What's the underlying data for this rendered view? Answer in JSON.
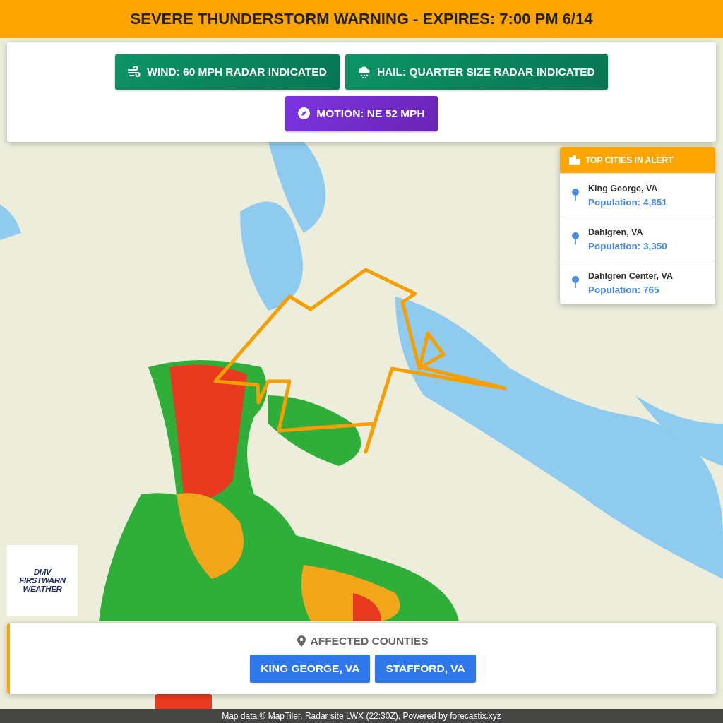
{
  "alert_banner": {
    "title": "SEVERE THUNDERSTORM WARNING - EXPIRES: 7:00 PM 6/14"
  },
  "hazard_tags": [
    {
      "kind": "wind",
      "text": "WIND: 60 MPH RADAR INDICATED"
    },
    {
      "kind": "hail",
      "text": "HAIL: QUARTER SIZE RADAR INDICATED"
    },
    {
      "kind": "motion",
      "text": "MOTION: NE 52 MPH"
    }
  ],
  "top_cities": {
    "title": "TOP CITIES IN ALERT",
    "cities": [
      {
        "name": "King George, VA",
        "population": "Population: 4,851"
      },
      {
        "name": "Dahlgren, VA",
        "population": "Population: 3,350"
      },
      {
        "name": "Dahlgren Center, VA",
        "population": "Population: 765"
      }
    ]
  },
  "logo": {
    "lines": [
      "DMV",
      "FIRSTWARN",
      "WEATHER"
    ]
  },
  "affected_counties": {
    "title": "AFFECTED COUNTIES",
    "counties": [
      "KING GEORGE, VA",
      "STAFFORD, VA"
    ]
  },
  "attribution": "Map data © MapTiler, Radar site LWX (22:30Z), Powered by forecastix.xyz"
}
